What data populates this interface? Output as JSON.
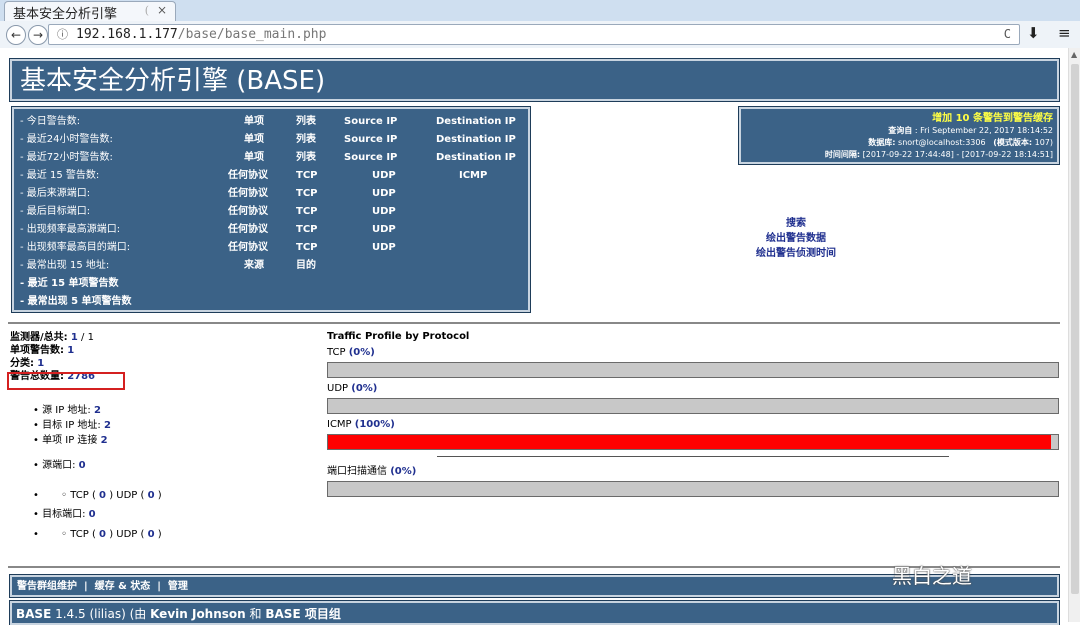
{
  "browser": {
    "tab_title": "基本安全分析引擎",
    "tab_sep": "(",
    "tab_close": "×",
    "url_host": "192.168.1.177",
    "url_path": "/base/base_main.php",
    "back": "←",
    "forward": "→",
    "info": "ⓘ",
    "reload": "C",
    "download": "⬇",
    "menu": "≡"
  },
  "header": {
    "title": "基本安全分析引擎 (BASE)"
  },
  "stats_rows": [
    {
      "label": "- 今日警告数:",
      "c1": "单项",
      "c2": "列表",
      "c3": "Source IP",
      "c4": "Destination IP"
    },
    {
      "label": "- 最近24小时警告数:",
      "c1": "单项",
      "c2": "列表",
      "c3": "Source IP",
      "c4": "Destination IP"
    },
    {
      "label": "- 最近72小时警告数:",
      "c1": "单项",
      "c2": "列表",
      "c3": "Source IP",
      "c4": "Destination IP"
    },
    {
      "label": "- 最近 15 警告数:",
      "c1": "任何协议",
      "c2": "TCP",
      "c3": "UDP",
      "c4": "ICMP"
    },
    {
      "label": "- 最后来源端口:",
      "c1": "任何协议",
      "c2": "TCP",
      "c3": "UDP",
      "c4": ""
    },
    {
      "label": "- 最后目标端口:",
      "c1": "任何协议",
      "c2": "TCP",
      "c3": "UDP",
      "c4": ""
    },
    {
      "label": "- 出现频率最高源端口:",
      "c1": "任何协议",
      "c2": "TCP",
      "c3": "UDP",
      "c4": ""
    },
    {
      "label": "- 出现频率最高目的端口:",
      "c1": "任何协议",
      "c2": "TCP",
      "c3": "UDP",
      "c4": ""
    },
    {
      "label": "- 最常出现 15 地址:",
      "c1": "来源",
      "c2": "目的",
      "c3": "",
      "c4": ""
    },
    {
      "label": "- 最近 15 单项警告数",
      "c1": "",
      "c2": "",
      "c3": "",
      "c4": ""
    },
    {
      "label": "- 最常出现 5 单项警告数",
      "c1": "",
      "c2": "",
      "c3": "",
      "c4": ""
    }
  ],
  "cache": {
    "add_link": "增加 10 条警告到警告缓存",
    "queried_label": "查询自",
    "queried_value": ": Fri September 22, 2017 18:14:52",
    "db_label": "数据库:",
    "db_value": "snort@localhost:3306",
    "schema_label": "(模式版本:",
    "schema_value": "107)",
    "time_label": "时间间隔:",
    "time_value": "[2017-09-22 17:44:48] - [2017-09-22 18:14:51]"
  },
  "links": {
    "search": "搜索",
    "graph_data": "绘出警告数据",
    "graph_time": "绘出警告侦测时间"
  },
  "summary": {
    "sensors_label": "监测器/总共:",
    "sensors_value": "1",
    "sensors_sep": "/",
    "sensors_total": "1",
    "unique_label": "单项警告数:",
    "unique_value": "1",
    "categories_label": "分类:",
    "categories_value": "1",
    "total_label": "警告总数量:",
    "total_value": "2786",
    "src_ip_label": "源 IP 地址:",
    "src_ip_value": "2",
    "dst_ip_label": "目标 IP 地址:",
    "dst_ip_value": "2",
    "links_label": "单项 IP 连接",
    "links_value": "2",
    "src_port_label": "源端口:",
    "src_port_value": "0",
    "dst_port_label": "目标端口:",
    "dst_port_value": "0",
    "tcp_label": "TCP",
    "udp_label": "UDP",
    "src_tcp": "0",
    "src_udp": "0",
    "dst_tcp": "0",
    "dst_udp": "0"
  },
  "traffic": {
    "title": "Traffic Profile by Protocol",
    "protocols": [
      {
        "name": "TCP",
        "pct_text": "(0%)",
        "percent": 0
      },
      {
        "name": "UDP",
        "pct_text": "(0%)",
        "percent": 0
      },
      {
        "name": "ICMP",
        "pct_text": "(100%)",
        "percent": 100
      }
    ],
    "portscan_label": "端口扫描通信",
    "portscan_pct_text": "(0%)",
    "portscan_percent": 0
  },
  "footer": {
    "nav1": "警告群组维护",
    "nav2": "缓存 & 状态",
    "nav3": "管理",
    "sep": "|",
    "version_name": "BASE",
    "version_rest": "1.4.5 (lilias) (由",
    "author": "Kevin Johnson",
    "and": "和",
    "team": "BASE 项目组"
  },
  "watermark": "黑白之道",
  "colors": {
    "header_bg": "#3b6287",
    "link": "#1f2f8f",
    "bar_fill": "#ff0000",
    "highlight": "#d42020",
    "cache_link": "#ffff44"
  }
}
